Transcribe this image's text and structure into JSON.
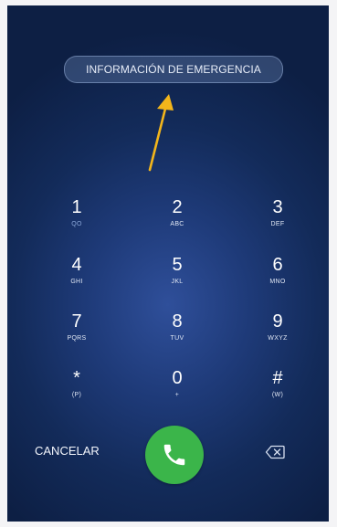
{
  "emergency": {
    "label": "INFORMACIÓN DE EMERGENCIA"
  },
  "keypad": {
    "keys": [
      {
        "digit": "1",
        "letters": "QO"
      },
      {
        "digit": "2",
        "letters": "ABC"
      },
      {
        "digit": "3",
        "letters": "DEF"
      },
      {
        "digit": "4",
        "letters": "GHI"
      },
      {
        "digit": "5",
        "letters": "JKL"
      },
      {
        "digit": "6",
        "letters": "MNO"
      },
      {
        "digit": "7",
        "letters": "PQRS"
      },
      {
        "digit": "8",
        "letters": "TUV"
      },
      {
        "digit": "9",
        "letters": "WXYZ"
      },
      {
        "digit": "*",
        "letters": "(P)"
      },
      {
        "digit": "0",
        "letters": "+"
      },
      {
        "digit": "#",
        "letters": "(W)"
      }
    ]
  },
  "actions": {
    "cancel_label": "CANCELAR",
    "call_icon": "phone-icon",
    "backspace_icon": "backspace-icon"
  },
  "colors": {
    "call_green": "#3bb54a",
    "arrow_yellow": "#f2b51b",
    "voicemail_blue": "#8aa7d9"
  }
}
